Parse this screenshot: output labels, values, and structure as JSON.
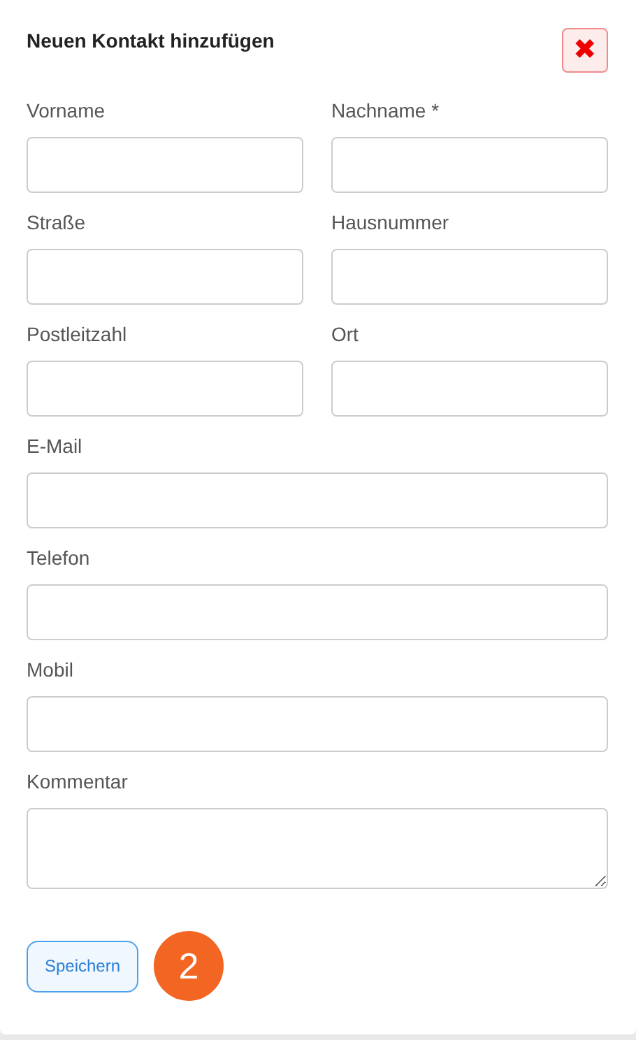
{
  "dialog": {
    "title": "Neuen Kontakt hinzufügen",
    "close_icon": "✖"
  },
  "fields": [
    {
      "label": "Vorname",
      "kind": "half"
    },
    {
      "label": "Nachname *",
      "kind": "half"
    },
    {
      "label": "Straße",
      "kind": "half"
    },
    {
      "label": "Hausnummer",
      "kind": "half"
    },
    {
      "label": "Postleitzahl",
      "kind": "half"
    },
    {
      "label": "Ort",
      "kind": "half"
    },
    {
      "label": "E-Mail",
      "kind": "full"
    },
    {
      "label": "Telefon",
      "kind": "full"
    },
    {
      "label": "Mobil",
      "kind": "full"
    },
    {
      "label": "Kommentar",
      "kind": "textarea"
    }
  ],
  "save_button": "Speichern",
  "step_badge": "2"
}
